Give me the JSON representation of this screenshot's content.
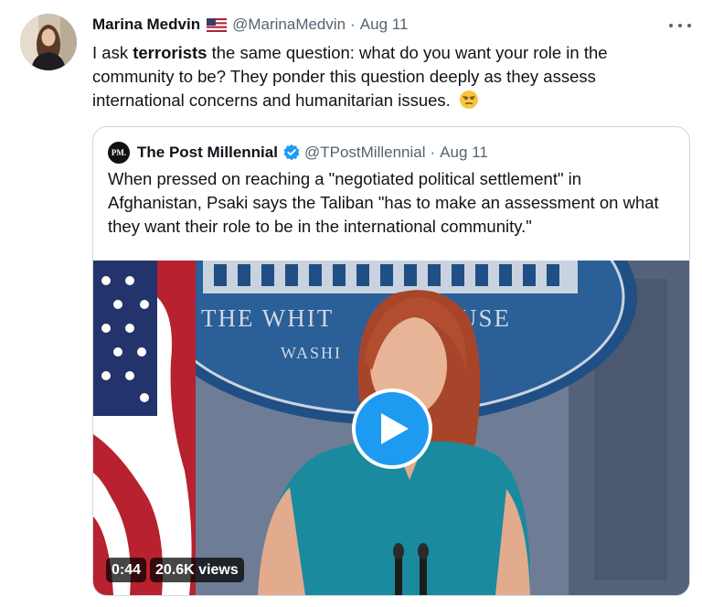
{
  "author": {
    "name": "Marina Medvin",
    "flag_icon": "us-flag-icon",
    "handle": "@MarinaMedvin",
    "separator": "·",
    "date": "Aug 11"
  },
  "tweet": {
    "text_before": "I ask ",
    "text_bold": "terrorists",
    "text_after": " the same question: what do you want your role in the community to be? They ponder this question deeply as they assess international concerns and humanitarian issues.",
    "emoji_icon": "unamused-face-emoji"
  },
  "more_icon": "more-horizontal-icon",
  "quote": {
    "avatar_text": "PM.",
    "name": "The Post Millennial",
    "verified_icon": "verified-badge-icon",
    "handle": "@TPostMillennial",
    "separator": "·",
    "date": "Aug 11",
    "text": "When pressed on reaching a \"negotiated political settlement\" in Afghanistan, Psaki says the Taliban \"has to make an assessment on what they want their role to be in the international community.\""
  },
  "video": {
    "duration": "0:44",
    "views": "20.6K views",
    "play_icon": "play-icon",
    "backdrop_text_line1": "THE WHIT",
    "backdrop_text_line1b": "USE",
    "backdrop_text_line2": "WASHI"
  },
  "colors": {
    "accent": "#1d9bf0",
    "secondary_text": "#536471",
    "border": "#cfd9de"
  }
}
